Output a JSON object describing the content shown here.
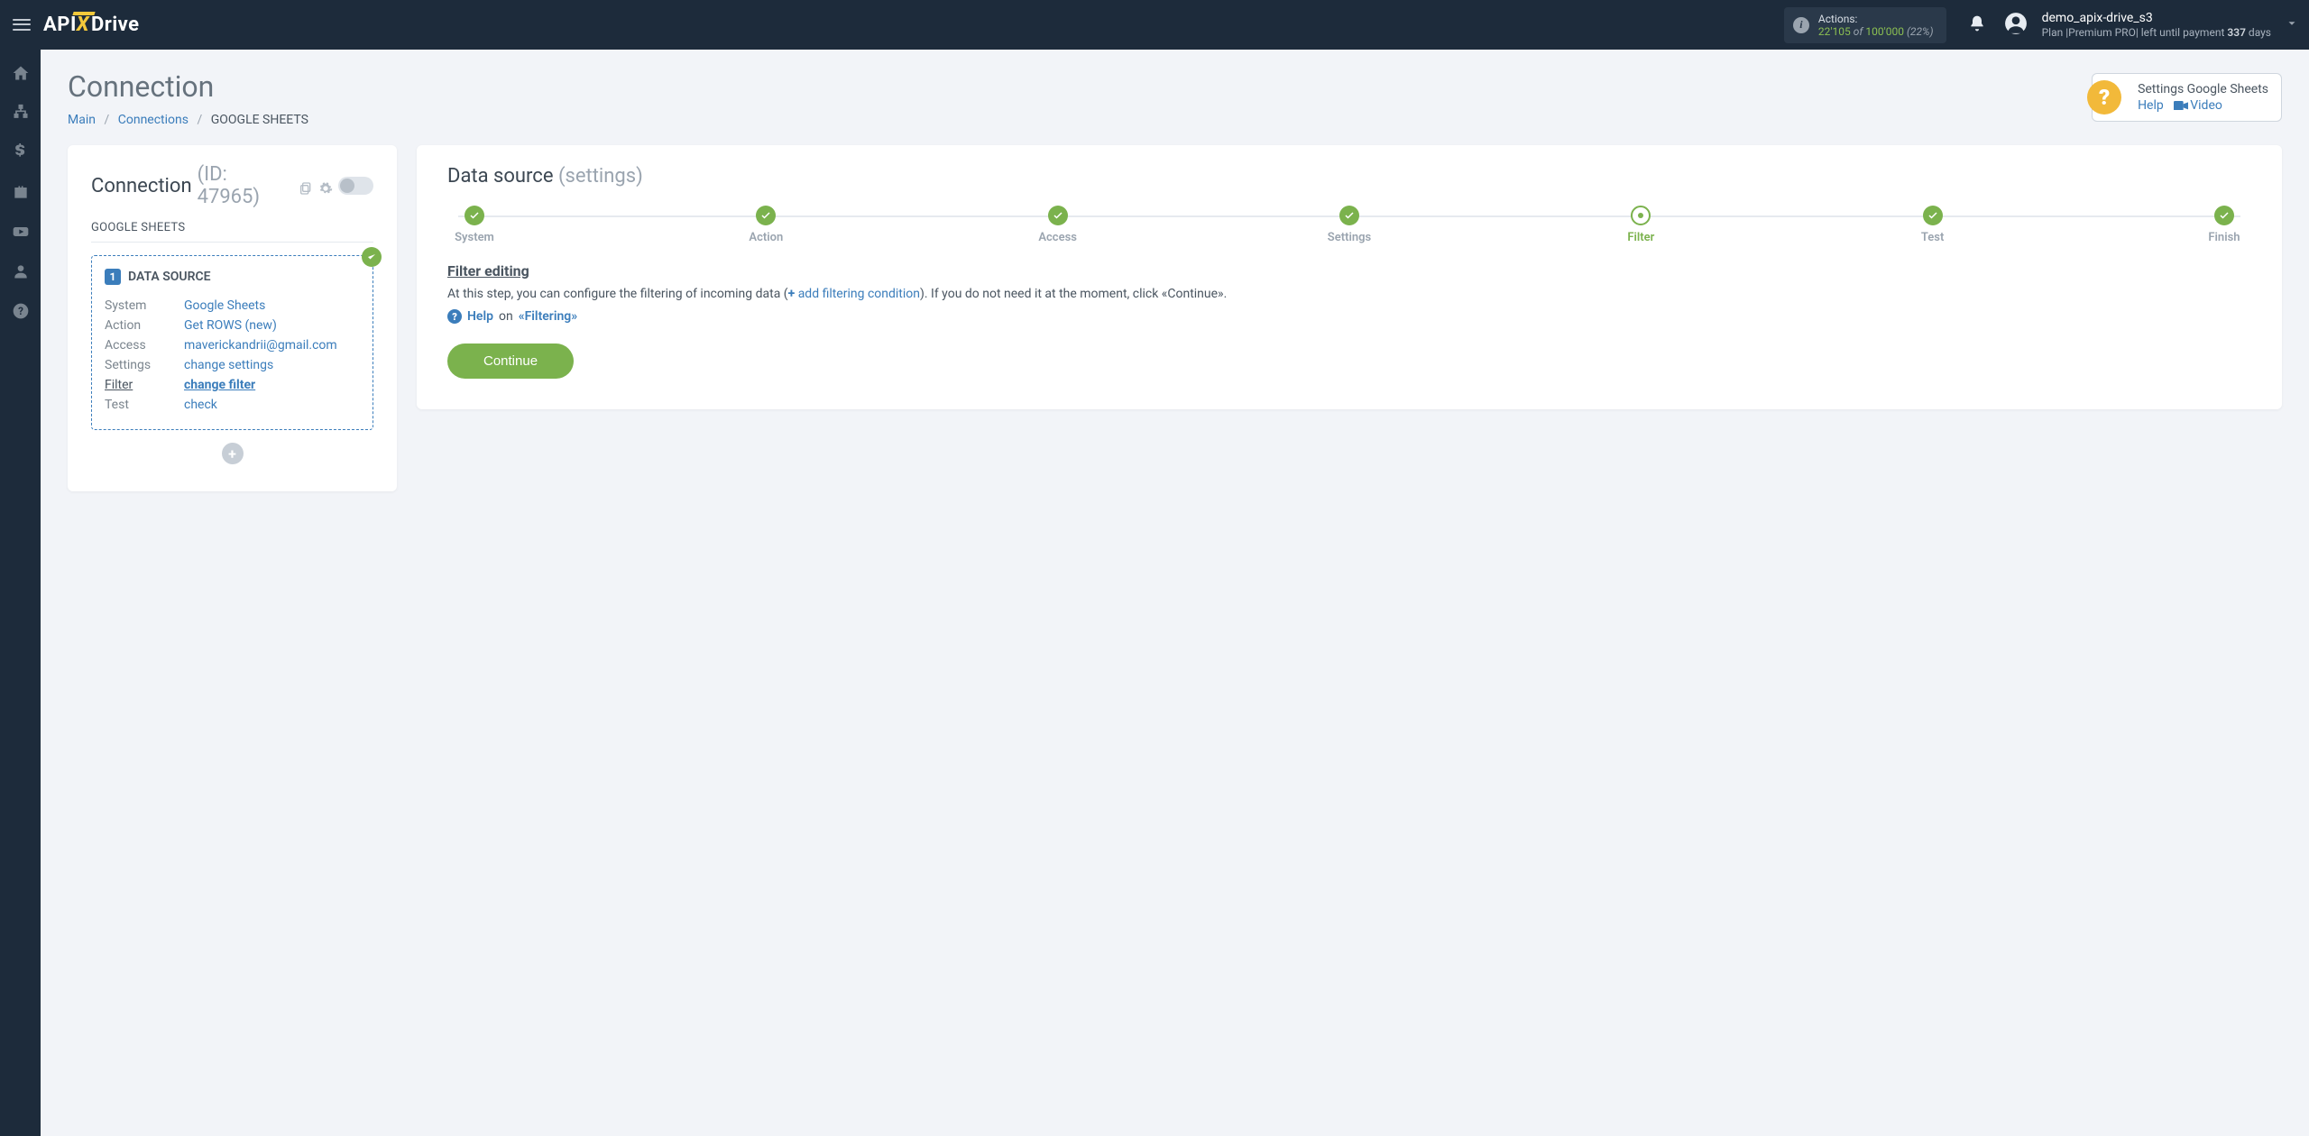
{
  "header": {
    "logo_parts": {
      "a": "API",
      "x": "X",
      "b": "Drive"
    },
    "actions": {
      "label": "Actions:",
      "used": "22'105",
      "of": "of",
      "total": "100'000",
      "pct": "(22%)"
    },
    "account": {
      "name": "demo_apix-drive_s3",
      "plan_prefix": "Plan |",
      "plan_name": "Premium PRO",
      "plan_suffix": "| left until payment",
      "days": "337",
      "days_unit": "days"
    }
  },
  "page": {
    "title": "Connection",
    "breadcrumbs": {
      "main": "Main",
      "connections": "Connections",
      "current": "GOOGLE SHEETS"
    }
  },
  "helpbox": {
    "title": "Settings Google Sheets",
    "help": "Help",
    "video": "Video"
  },
  "sidepanel": {
    "heading": "Connection",
    "id_label": "(ID: 47965)",
    "system_name": "GOOGLE SHEETS",
    "ds": {
      "section_label": "DATA SOURCE",
      "rows": {
        "system": {
          "k": "System",
          "v": "Google Sheets"
        },
        "action": {
          "k": "Action",
          "v": "Get ROWS (new)"
        },
        "access": {
          "k": "Access",
          "v": "maverickandrii@gmail.com"
        },
        "settings": {
          "k": "Settings",
          "v": "change settings"
        },
        "filter": {
          "k": "Filter",
          "v": "change filter"
        },
        "test": {
          "k": "Test",
          "v": "check"
        }
      }
    }
  },
  "mainpanel": {
    "title": "Data source",
    "subtitle": "(settings)",
    "steps": [
      {
        "label": "System",
        "state": "done"
      },
      {
        "label": "Action",
        "state": "done"
      },
      {
        "label": "Access",
        "state": "done"
      },
      {
        "label": "Settings",
        "state": "done"
      },
      {
        "label": "Filter",
        "state": "current"
      },
      {
        "label": "Test",
        "state": "done"
      },
      {
        "label": "Finish",
        "state": "done"
      }
    ],
    "filter": {
      "heading": "Filter editing",
      "desc_pre": "At this step, you can configure the filtering of incoming data (",
      "add_link": "add filtering condition",
      "desc_post": "). If you do not need it at the moment, click «Continue».",
      "help_label": "Help",
      "help_on": "on",
      "help_topic": "«Filtering»"
    },
    "continue": "Continue"
  }
}
